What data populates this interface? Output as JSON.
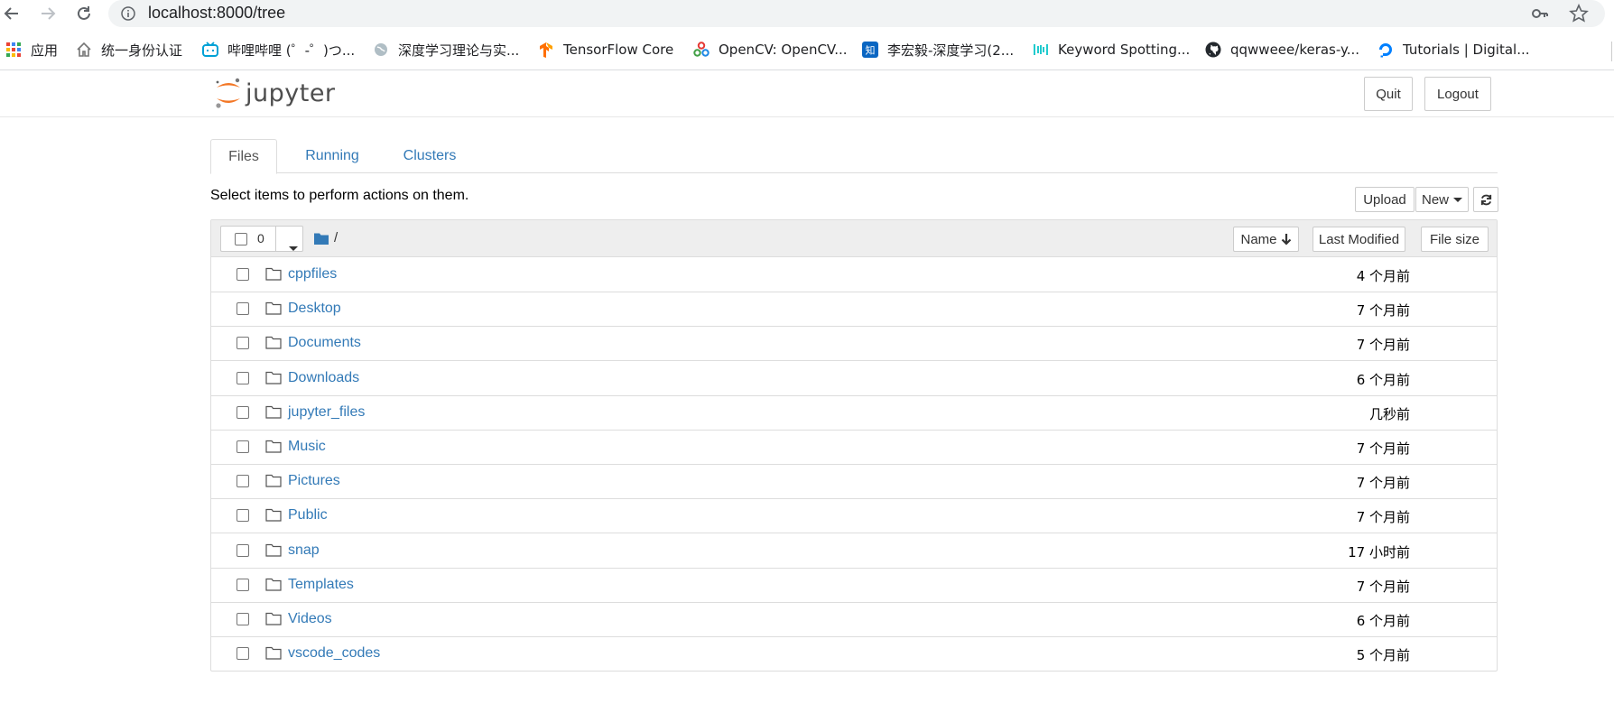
{
  "browser": {
    "url": "localhost:8000/tree",
    "bookmarks": [
      {
        "label": "应用",
        "icon": "apps-grid-icon"
      },
      {
        "label": "统一身份认证",
        "icon": "home-icon"
      },
      {
        "label": "哔哩哔哩 (゜-゜)つ...",
        "icon": "bilibili-icon"
      },
      {
        "label": "深度学习理论与实...",
        "icon": "globe-icon"
      },
      {
        "label": "TensorFlow Core",
        "icon": "tensorflow-icon"
      },
      {
        "label": "OpenCV: OpenCV...",
        "icon": "opencv-icon"
      },
      {
        "label": "李宏毅-深度学习(2...",
        "icon": "zhihu-icon"
      },
      {
        "label": "Keyword Spotting...",
        "icon": "paperswithcode-icon"
      },
      {
        "label": "qqwweee/keras-y...",
        "icon": "github-icon"
      },
      {
        "label": "Tutorials | Digital...",
        "icon": "digitalocean-icon"
      }
    ]
  },
  "header": {
    "logo_text": "jupyter",
    "quit_label": "Quit",
    "logout_label": "Logout"
  },
  "tabs": [
    {
      "label": "Files",
      "active": true
    },
    {
      "label": "Running",
      "active": false
    },
    {
      "label": "Clusters",
      "active": false
    }
  ],
  "toolbar": {
    "hint": "Select items to perform actions on them.",
    "upload_label": "Upload",
    "new_label": "New"
  },
  "list": {
    "selected_count": "0",
    "path": "/",
    "sort_name_label": "Name",
    "sort_modified_label": "Last Modified",
    "sort_size_label": "File size",
    "items": [
      {
        "name": "cppfiles",
        "modified": "4 个月前"
      },
      {
        "name": "Desktop",
        "modified": "7 个月前"
      },
      {
        "name": "Documents",
        "modified": "7 个月前"
      },
      {
        "name": "Downloads",
        "modified": "6 个月前"
      },
      {
        "name": "jupyter_files",
        "modified": "几秒前"
      },
      {
        "name": "Music",
        "modified": "7 个月前"
      },
      {
        "name": "Pictures",
        "modified": "7 个月前"
      },
      {
        "name": "Public",
        "modified": "7 个月前"
      },
      {
        "name": "snap",
        "modified": "17 小时前"
      },
      {
        "name": "Templates",
        "modified": "7 个月前"
      },
      {
        "name": "Videos",
        "modified": "6 个月前"
      },
      {
        "name": "vscode_codes",
        "modified": "5 个月前"
      }
    ]
  },
  "colors": {
    "link": "#337ab7",
    "jupyter_orange": "#f37726"
  }
}
